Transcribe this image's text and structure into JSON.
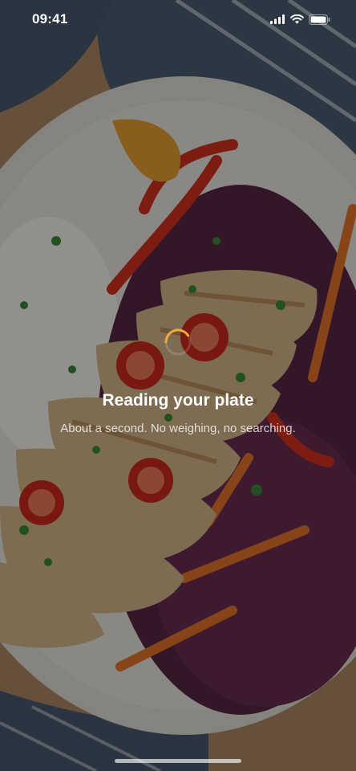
{
  "status": {
    "time": "09:41"
  },
  "loading": {
    "title": "Reading your plate",
    "subtitle": "About a second. No weighing, no searching."
  },
  "colors": {
    "spinner_accent": "#f2a93b",
    "overlay": "rgba(0,0,0,0.42)"
  },
  "icons": {
    "signal": "signal-icon",
    "wifi": "wifi-icon",
    "battery": "battery-icon",
    "spinner": "loading-spinner"
  }
}
